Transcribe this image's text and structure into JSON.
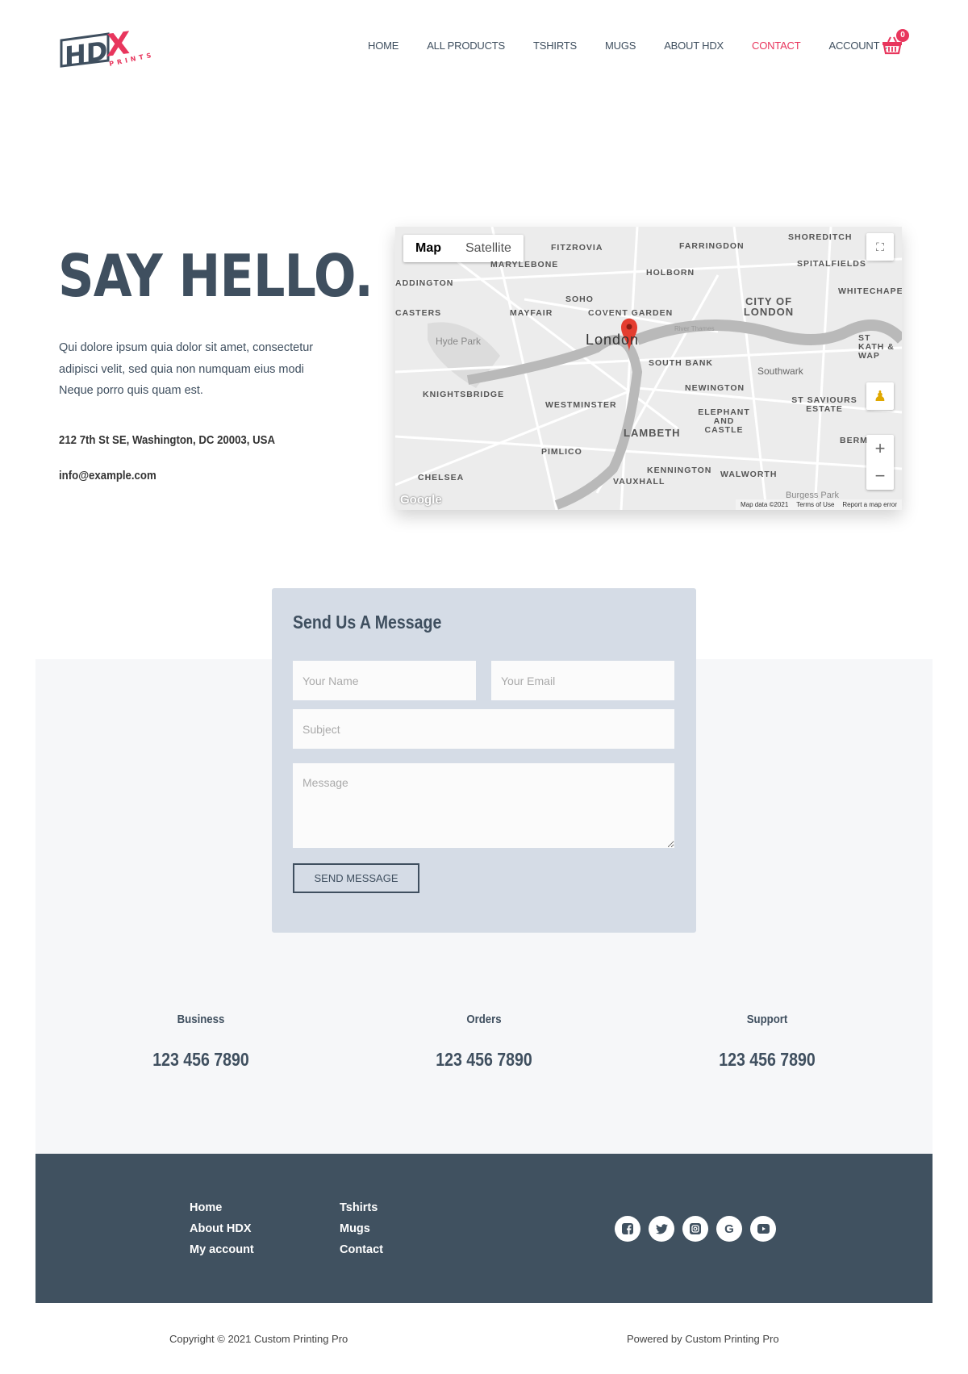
{
  "brand": {
    "logo_text": "HDX",
    "logo_sub": "PRINTS",
    "accent": "#e8365d",
    "dark": "#3f4f5f"
  },
  "nav": {
    "items": [
      "HOME",
      "ALL PRODUCTS",
      "TSHIRTS",
      "MUGS",
      "ABOUT HDX",
      "CONTACT",
      "ACCOUNT"
    ],
    "active": "CONTACT",
    "cart_count": "0"
  },
  "hero": {
    "title": "SAY HELLO.",
    "paragraph": "Qui dolore ipsum quia dolor sit amet, consectetur adipisci velit, sed quia non numquam eius modi Neque porro quis quam est.",
    "address": "212 7th St SE, Washington, DC 20003, USA",
    "email": "info@example.com"
  },
  "map": {
    "tabs": [
      "Map",
      "Satellite"
    ],
    "active_tab": "Map",
    "labels": [
      "FITZROVIA",
      "FARRINGDON",
      "SHOREDITCH",
      "MARYLEBONE",
      "HOLBORN",
      "SPITALFIELDS",
      "ADDINGTON",
      "SOHO",
      "WHITECHAPEL",
      "CASTERS",
      "MAYFAIR",
      "COVENT GARDEN",
      "CITY OF LONDON",
      "Hyde Park",
      "London",
      "SOUTH BANK",
      "ST KATH & WAP",
      "Southwark",
      "KNIGHTSBRIDGE",
      "NEWINGTON",
      "WESTMINSTER",
      "ST SAVIOURS ESTATE",
      "ELEPHANT AND CASTLE",
      "LAMBETH",
      "PIMLICO",
      "BERM",
      "KENNINGTON",
      "CHELSEA",
      "WALWORTH",
      "VAUXHALL",
      "Burgess Park",
      "River Thames"
    ],
    "attribution": "Map data ©2021",
    "terms": "Terms of Use",
    "report": "Report a map error",
    "google": "Google",
    "zoom_in": "+",
    "zoom_out": "−"
  },
  "form": {
    "title": "Send Us A Message",
    "name_placeholder": "Your Name",
    "email_placeholder": "Your Email",
    "subject_placeholder": "Subject",
    "message_placeholder": "Message",
    "submit": "SEND MESSAGE"
  },
  "contacts": [
    {
      "label": "Business",
      "phone": "123 456 7890"
    },
    {
      "label": "Orders",
      "phone": "123 456 7890"
    },
    {
      "label": "Support",
      "phone": "123 456 7890"
    }
  ],
  "footer": {
    "col1": [
      "Home",
      "About HDX",
      "My account"
    ],
    "col2": [
      "Tshirts",
      "Mugs",
      "Contact"
    ],
    "social": [
      "facebook-icon",
      "twitter-icon",
      "instagram-icon",
      "google-icon",
      "youtube-icon"
    ],
    "copyright": "Copyright © 2021 Custom Printing Pro",
    "powered": "Powered by Custom Printing Pro"
  }
}
